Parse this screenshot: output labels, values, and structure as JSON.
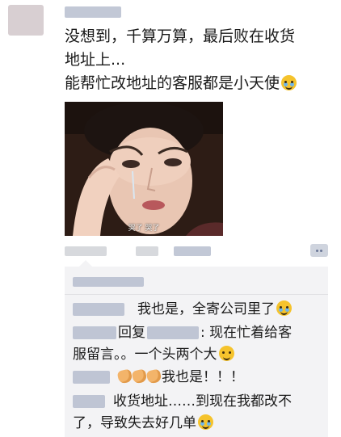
{
  "post": {
    "lines": [
      "没想到，千算万算，最后败在收货",
      "地址上...",
      "能帮忙改地址的客服都是小天使"
    ],
    "emoji": "pleading-face-icon",
    "image_caption": "哭了   哭了"
  },
  "comments": [
    {
      "text": "我也是，全寄公司里了",
      "emoji": "crying-laughing-icon"
    },
    {
      "reply_label": "回复",
      "text_1": ": 现在忙着给客",
      "text_2": "服留言。。一个头两个大",
      "emoji": "smirking-face-icon"
    },
    {
      "emoji": "clapping-hands-icon",
      "text": "我也是！！！"
    },
    {
      "text_1": "收货地址……到现在我都改不",
      "text_2": "了，导致失去好几单",
      "emoji": "crying-laughing-icon"
    }
  ],
  "colors": {
    "comment_panel_bg": "#f3f3f5",
    "name_blur": "#aeb6c8"
  }
}
